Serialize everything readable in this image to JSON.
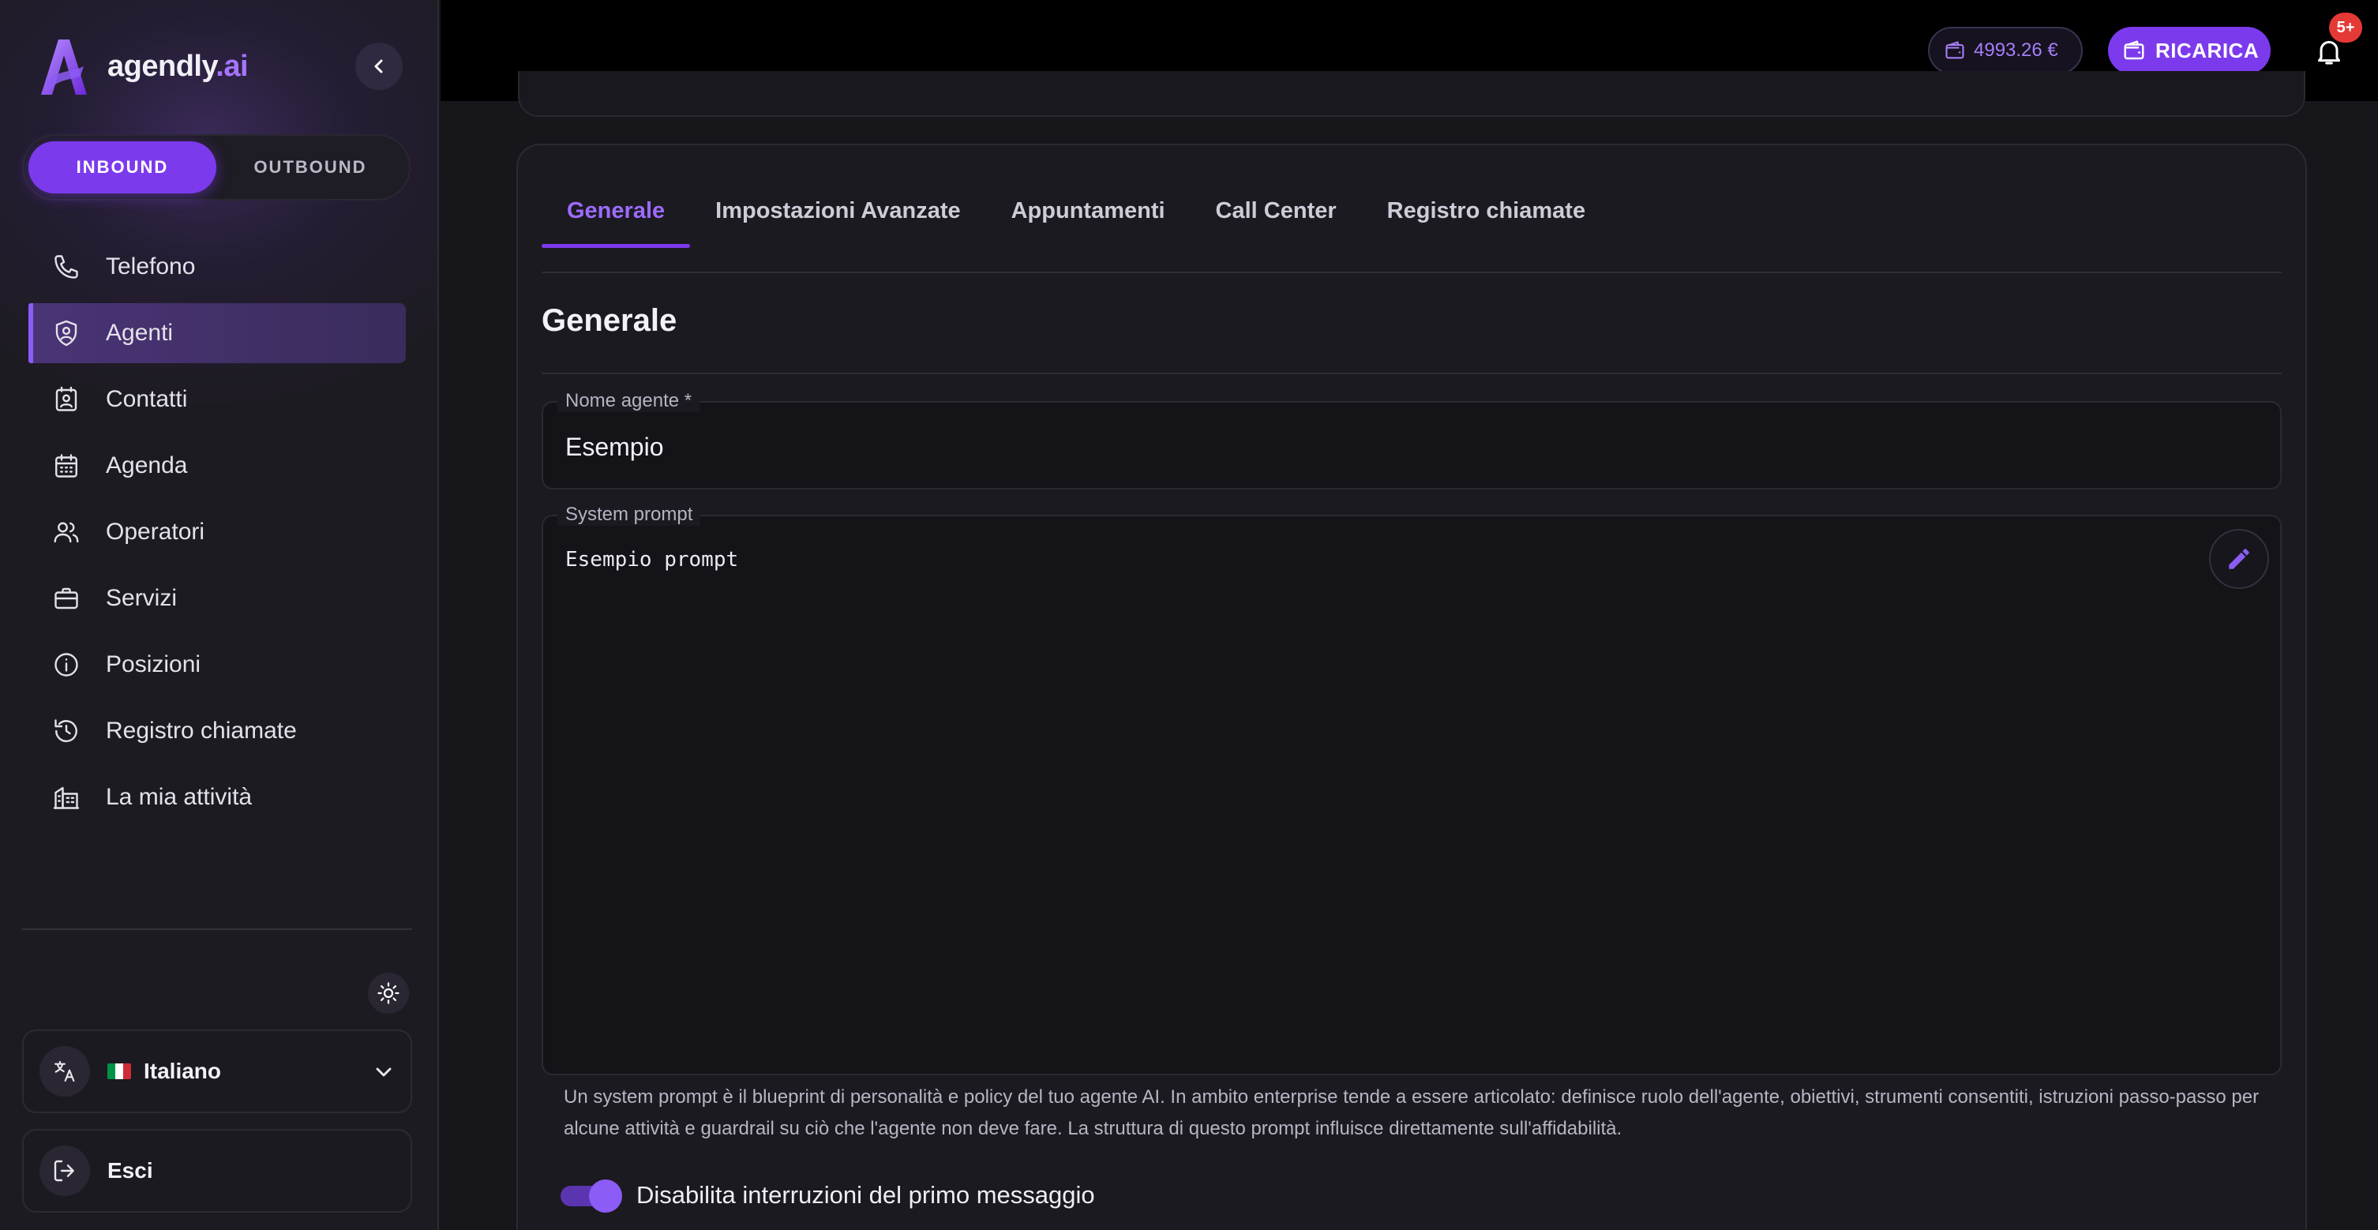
{
  "brand": {
    "name": "agendly",
    "suffix": ".ai"
  },
  "mode_toggle": {
    "inbound": "INBOUND",
    "outbound": "OUTBOUND",
    "active": "inbound"
  },
  "nav": {
    "items": [
      {
        "label": "Telefono",
        "icon": "phone-icon"
      },
      {
        "label": "Agenti",
        "icon": "agent-shield-icon",
        "active": true
      },
      {
        "label": "Contatti",
        "icon": "contacts-icon"
      },
      {
        "label": "Agenda",
        "icon": "calendar-icon"
      },
      {
        "label": "Operatori",
        "icon": "users-icon"
      },
      {
        "label": "Servizi",
        "icon": "briefcase-icon"
      },
      {
        "label": "Posizioni",
        "icon": "location-icon"
      },
      {
        "label": "Registro chiamate",
        "icon": "history-icon"
      },
      {
        "label": "La mia attività",
        "icon": "building-icon"
      }
    ]
  },
  "language": {
    "label": "Italiano",
    "flag_colors": [
      "#009246",
      "#ffffff",
      "#ce2b37"
    ]
  },
  "logout": {
    "label": "Esci"
  },
  "topbar": {
    "balance": "4993.26 €",
    "recharge_label": "RICARICA",
    "notifications_badge": "5+"
  },
  "tabs": [
    {
      "label": "Generale",
      "active": true
    },
    {
      "label": "Impostazioni Avanzate"
    },
    {
      "label": "Appuntamenti"
    },
    {
      "label": "Call Center"
    },
    {
      "label": "Registro chiamate"
    }
  ],
  "section": {
    "title": "Generale"
  },
  "form": {
    "agent_name": {
      "label": "Nome agente *",
      "value": "Esempio"
    },
    "system_prompt": {
      "label": "System prompt",
      "value": "Esempio prompt",
      "helper": "Un system prompt è il blueprint di personalità e policy del tuo agente AI. In ambito enterprise tende a essere articolato: definisce ruolo dell'agente, obiettivi, strumenti consentiti, istruzioni passo-passo per alcune attività e guardrail su ciò che l'agente non deve fare. La struttura di questo prompt influisce direttamente sull'affidabilità."
    },
    "disable_interruptions": {
      "label": "Disabilita interruzioni del primo messaggio",
      "checked": true
    }
  },
  "colors": {
    "accent": "#7c3aed",
    "accent_text": "#9d6bff",
    "badge": "#e53935"
  }
}
